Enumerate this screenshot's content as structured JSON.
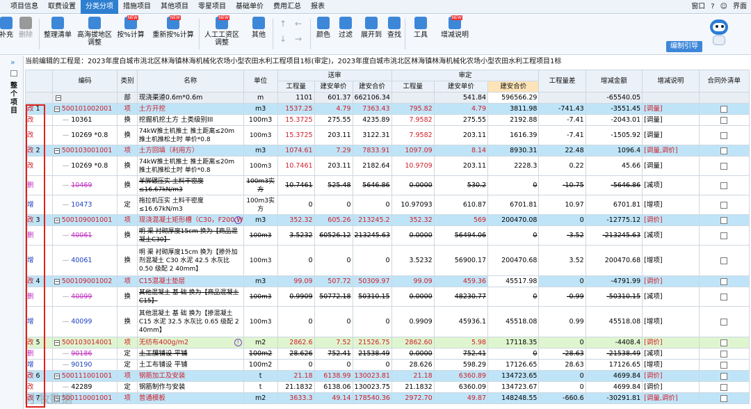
{
  "menu": {
    "tabs": [
      "项目信息",
      "取费设置",
      "分类分项",
      "措施项目",
      "其他项目",
      "零星项目",
      "基础单价",
      "费用汇总",
      "报表"
    ],
    "active": "分类分项",
    "right": [
      "窗口",
      "界面"
    ]
  },
  "toolbar": {
    "items": [
      {
        "label": "补充",
        "name": "supplement-button",
        "icon": "supplement-icon",
        "color": "#3d87d9"
      },
      {
        "label": "删除",
        "name": "delete-button",
        "icon": "trash-icon",
        "color": "#999",
        "disabled": true
      },
      {
        "label": "整理清单",
        "name": "organize-list-button",
        "icon": "list-icon",
        "color": "#3d87d9"
      },
      {
        "label": "高海拔地区 调整",
        "name": "altitude-adjust-button",
        "icon": "mountain-icon",
        "color": "#3d87d9"
      },
      {
        "label": "按%计算",
        "name": "percent-calc-button",
        "icon": "percent-icon",
        "color": "#3d87d9",
        "badge": true
      },
      {
        "label": "重新按%计算",
        "name": "recalc-percent-button",
        "icon": "percent-icon",
        "color": "#3d87d9",
        "badge": true
      },
      {
        "label": "人工工资区 调整",
        "name": "wage-adjust-button",
        "icon": "wage-icon",
        "color": "#3d87d9",
        "badge": true
      },
      {
        "label": "其他",
        "name": "other-button",
        "icon": "grid-icon",
        "color": "#3d87d9"
      },
      {
        "label": "颜色",
        "name": "color-button",
        "icon": "paint-icon",
        "color": "#3d87d9"
      },
      {
        "label": "过滤",
        "name": "filter-button",
        "icon": "filter-icon",
        "color": "#3d87d9"
      },
      {
        "label": "展开到",
        "name": "expand-button",
        "icon": "expand-icon",
        "color": "#3d87d9"
      },
      {
        "label": "查找",
        "name": "find-button",
        "icon": "search-icon",
        "color": "#3d87d9"
      },
      {
        "label": "工具",
        "name": "tools-button",
        "icon": "tools-icon",
        "color": "#3d87d9"
      },
      {
        "label": "增减说明",
        "name": "change-note-button",
        "icon": "note-icon",
        "color": "#3d87d9",
        "badge": true
      }
    ],
    "badge_text": "NEW",
    "edit_guide": "编制引导"
  },
  "left_panel": {
    "title": "整个项目"
  },
  "notice": "当前编辑的工程是：2023年度白城市洮北区林海镇林海机械化农场小型农田水利工程项目1标(审定)，2023年度白城市洮北区林海镇林海机械化农场小型农田水利工程项目1标",
  "table": {
    "group_headers": {
      "submit": "送审",
      "approve": "审定"
    },
    "columns": [
      "编码",
      "类别",
      "名称",
      "单位",
      "工程量",
      "建安单价",
      "建安合价",
      "工程量",
      "建安单价",
      "建安合价",
      "工程量差",
      "增减金额",
      "增减说明",
      "合同外清单"
    ],
    "rows": [
      {
        "tag": "",
        "idx": "",
        "code": "",
        "type": "部",
        "name": "现浇渠道0.6m*0.6m",
        "unit": "m",
        "sq": "1101",
        "sp": "601.37",
        "st": "662106.34",
        "aq": "",
        "ap": "541.84",
        "at": "596566.29",
        "dq": "",
        "dm": "-65540.05",
        "note": "",
        "style": "head"
      },
      {
        "tag": "改",
        "idx": "1",
        "code": "500101002001",
        "type": "项",
        "name": "土方开挖",
        "unit": "m3",
        "sq": "1537.25",
        "sp": "4.79",
        "st": "7363.43",
        "aq": "795.82",
        "ap": "4.79",
        "at": "3811.98",
        "dq": "-741.43",
        "dm": "-3551.45",
        "note": "[调量]",
        "style": "blue",
        "box": "−"
      },
      {
        "tag": "改",
        "idx": "",
        "code": "10361",
        "type": "换",
        "name": "挖掘机挖土方 土类级别III",
        "unit": "100m3",
        "sq": "15.3725",
        "sp": "275.55",
        "st": "4235.89",
        "aq": "7.9582",
        "ap": "275.55",
        "at": "2192.88",
        "dq": "-7.41",
        "dm": "-2043.01",
        "note": "[调量]",
        "style": "sub",
        "sqred": true,
        "aqred": true
      },
      {
        "tag": "改",
        "idx": "",
        "code": "10269 *0.8",
        "type": "换",
        "name": "74kW推土机推土 推土距离≤20m 推土机推松土时 单价*0.8",
        "unit": "100m3",
        "sq": "15.3725",
        "sp": "203.11",
        "st": "3122.31",
        "aq": "7.9582",
        "ap": "203.11",
        "at": "1616.39",
        "dq": "-7.41",
        "dm": "-1505.92",
        "note": "[调量]",
        "style": "sub2",
        "sqred": true,
        "aqred": true
      },
      {
        "tag": "改",
        "idx": "2",
        "code": "500103001001",
        "type": "项",
        "name": "土方回填（利用方）",
        "unit": "m3",
        "sq": "1074.61",
        "sp": "7.29",
        "st": "7833.91",
        "aq": "1097.09",
        "ap": "8.14",
        "at": "8930.31",
        "dq": "22.48",
        "dm": "1096.4",
        "note": "[调量,调价]",
        "style": "blue",
        "box": "−"
      },
      {
        "tag": "改",
        "idx": "",
        "code": "10269 *0.8",
        "type": "换",
        "name": "74kW推土机推土 推土距离≤20m 推土机推松土时 单价*0.8",
        "unit": "100m3",
        "sq": "10.7461",
        "sp": "203.11",
        "st": "2182.64",
        "aq": "10.9709",
        "ap": "203.11",
        "at": "2228.3",
        "dq": "0.22",
        "dm": "45.66",
        "note": "[调量]",
        "style": "sub2",
        "sqred": true,
        "aqred": true
      },
      {
        "tag": "删",
        "idx": "",
        "code": "10469",
        "type": "换",
        "name": "羊脚碾压实 土料干密度≤16.67kN/m3",
        "unit": "100m3实方",
        "sq": "10.7461",
        "sp": "525.48",
        "st": "5646.86",
        "aq": "0.0000",
        "ap": "530.2",
        "at": "0",
        "dq": "-10.75",
        "dm": "-5646.86",
        "note": "[减项]",
        "style": "sub2",
        "strike": true
      },
      {
        "tag": "增",
        "idx": "",
        "code": "10473",
        "type": "定",
        "name": "拖拉机压实 土料干密度≤16.67kN/m3",
        "unit": "100m3实方",
        "sq": "0",
        "sp": "0",
        "st": "0",
        "aq": "10.97093",
        "ap": "610.87",
        "at": "6701.81",
        "dq": "10.97",
        "dm": "6701.81",
        "note": "[增项]",
        "style": "sub2"
      },
      {
        "tag": "改",
        "idx": "3",
        "code": "500109001001",
        "type": "项",
        "name": "现浇混凝土矩形槽（C30，F200,W4）",
        "unit": "m3",
        "sq": "352.32",
        "sp": "605.26",
        "st": "213245.2",
        "aq": "352.32",
        "ap": "569",
        "at": "200470.08",
        "dq": "0",
        "dm": "-12775.12",
        "note": "[调价]",
        "style": "blue2",
        "box": "−",
        "warn": true
      },
      {
        "tag": "删",
        "idx": "",
        "code": "40061",
        "type": "换",
        "name": "明 渠 衬砌厚度15cm 换为【商品混凝土C30】",
        "unit": "100m3",
        "sq": "3.5232",
        "sp": "60526.12",
        "st": "213245.63",
        "aq": "0.0000",
        "ap": "56494.06",
        "at": "0",
        "dq": "-3.52",
        "dm": "-213245.63",
        "note": "[减项]",
        "style": "sub2",
        "strike": true
      },
      {
        "tag": "增",
        "idx": "",
        "code": "40061",
        "type": "换",
        "name": "明 渠 衬砌厚度15cm 换为【掺外加剂混凝土 C30 水泥 42.5 水灰比 0.50 级配 2 40mm】",
        "unit": "100m3",
        "sq": "0",
        "sp": "0",
        "st": "0",
        "aq": "3.5232",
        "ap": "56900.17",
        "at": "200470.68",
        "dq": "3.52",
        "dm": "200470.68",
        "note": "[增项]",
        "style": "sub3"
      },
      {
        "tag": "改",
        "idx": "4",
        "code": "500109001002",
        "type": "项",
        "name": "C15混凝土垫层",
        "unit": "m3",
        "sq": "99.09",
        "sp": "507.72",
        "st": "50309.97",
        "aq": "99.09",
        "ap": "459.36",
        "at": "45517.98",
        "dq": "0",
        "dm": "-4791.99",
        "note": "[调价]",
        "style": "blue",
        "box": "−"
      },
      {
        "tag": "删",
        "idx": "",
        "code": "40099",
        "type": "换",
        "name": "其他混凝土 基 础 换为【商品混凝土C15】",
        "unit": "100m3",
        "sq": "0.9909",
        "sp": "50772.18",
        "st": "50310.15",
        "aq": "0.0000",
        "ap": "48230.77",
        "at": "0",
        "dq": "-0.99",
        "dm": "-50310.15",
        "note": "[减项]",
        "style": "sub2",
        "strike": true
      },
      {
        "tag": "增",
        "idx": "",
        "code": "40099",
        "type": "换",
        "name": "其他混凝土 基 础 换为【掺混凝土 C15 水泥 32.5 水灰比 0.65 级配 2 40mm】",
        "unit": "100m3",
        "sq": "0",
        "sp": "0",
        "st": "0",
        "aq": "0.9909",
        "ap": "45936.1",
        "at": "45518.08",
        "dq": "0.99",
        "dm": "45518.08",
        "note": "[增项]",
        "style": "sub3"
      },
      {
        "tag": "改",
        "idx": "5",
        "code": "500103014001",
        "type": "项",
        "name": "无纺布400g/m2",
        "unit": "m2",
        "sq": "2862.6",
        "sp": "7.52",
        "st": "21526.75",
        "aq": "2862.60",
        "ap": "5.98",
        "at": "17118.35",
        "dq": "0",
        "dm": "-4408.4",
        "note": "[调价]",
        "style": "green",
        "box": "−",
        "warn": true
      },
      {
        "tag": "删",
        "idx": "",
        "code": "90186",
        "type": "定",
        "name": "土工膜铺设 平铺",
        "unit": "100m2",
        "sq": "28.626",
        "sp": "752.41",
        "st": "21538.49",
        "aq": "0.0000",
        "ap": "752.41",
        "at": "0",
        "dq": "-28.63",
        "dm": "-21538.49",
        "note": "[减项]",
        "style": "sub",
        "strike": true
      },
      {
        "tag": "增",
        "idx": "",
        "code": "90190",
        "type": "定",
        "name": "土工布铺设 平铺",
        "unit": "100m2",
        "sq": "0",
        "sp": "0",
        "st": "0",
        "aq": "28.626",
        "ap": "598.29",
        "at": "17126.65",
        "dq": "28.63",
        "dm": "17126.65",
        "note": "[增项]",
        "style": "sub"
      },
      {
        "tag": "改",
        "idx": "6",
        "code": "500111001001",
        "type": "项",
        "name": "钢筋加工及安装",
        "unit": "t",
        "sq": "21.18",
        "sp": "6138.99",
        "st": "130023.81",
        "aq": "21.18",
        "ap": "6360.89",
        "at": "134723.65",
        "dq": "0",
        "dm": "4699.84",
        "note": "[调价]",
        "style": "blue",
        "box": "−"
      },
      {
        "tag": "改",
        "idx": "",
        "code": "42289",
        "type": "定",
        "name": "钢筋制作与安装",
        "unit": "t",
        "sq": "21.1832",
        "sp": "6138.06",
        "st": "130023.75",
        "aq": "21.1832",
        "ap": "6360.09",
        "at": "134723.67",
        "dq": "0",
        "dm": "4699.84",
        "note": "[调价]",
        "style": "sub"
      },
      {
        "tag": "改",
        "idx": "7",
        "code": "500110001001",
        "type": "项",
        "name": "普通模板",
        "unit": "m2",
        "sq": "3633.3",
        "sp": "49.14",
        "st": "178540.36",
        "aq": "2972.70",
        "ap": "49.87",
        "at": "148248.55",
        "dq": "-660.6",
        "dm": "-30291.81",
        "note": "[调量,调价]",
        "style": "blue",
        "box": "−"
      }
    ]
  },
  "watermark": "小牧数据"
}
